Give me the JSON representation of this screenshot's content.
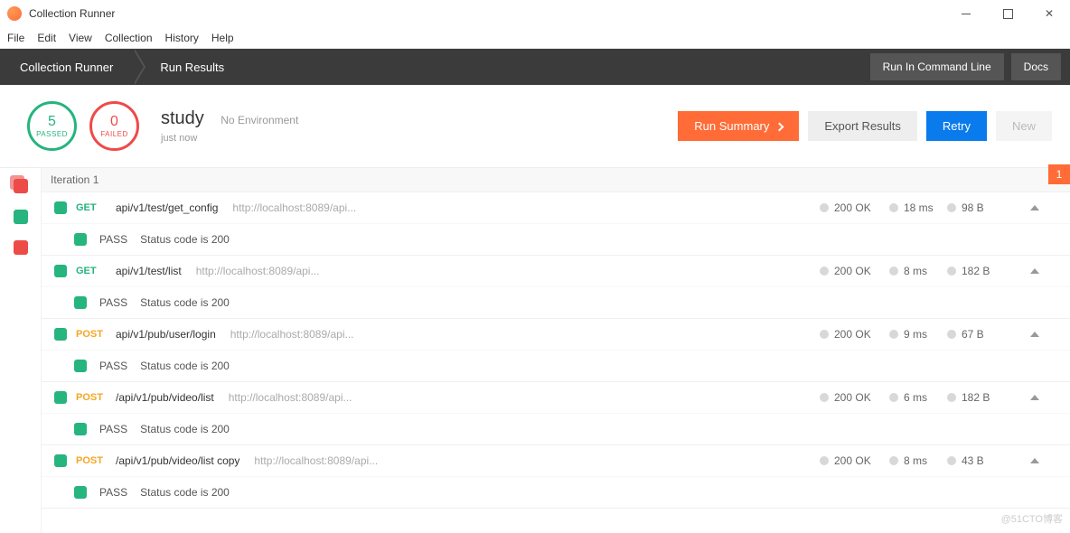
{
  "window": {
    "title": "Collection Runner"
  },
  "menu": [
    "File",
    "Edit",
    "View",
    "Collection",
    "History",
    "Help"
  ],
  "tabs": {
    "crumb1": "Collection Runner",
    "crumb2": "Run Results",
    "cmd": "Run In Command Line",
    "docs": "Docs"
  },
  "summary": {
    "passed_n": "5",
    "passed_l": "PASSED",
    "failed_n": "0",
    "failed_l": "FAILED",
    "name": "study",
    "env": "No Environment",
    "time": "just now"
  },
  "actions": {
    "run_summary": "Run Summary",
    "export": "Export Results",
    "retry": "Retry",
    "new": "New"
  },
  "iteration": {
    "label": "Iteration 1",
    "badge": "1"
  },
  "requests": [
    {
      "method": "GET",
      "mcls": "get",
      "path": "api/v1/test/get_config",
      "url": "http://localhost:8089/api...",
      "status": "200 OK",
      "time": "18 ms",
      "size": "98 B",
      "assert": "Status code is 200"
    },
    {
      "method": "GET",
      "mcls": "get",
      "path": "api/v1/test/list",
      "url": "http://localhost:8089/api...",
      "status": "200 OK",
      "time": "8 ms",
      "size": "182 B",
      "assert": "Status code is 200"
    },
    {
      "method": "POST",
      "mcls": "post",
      "path": "api/v1/pub/user/login",
      "url": "http://localhost:8089/api...",
      "status": "200 OK",
      "time": "9 ms",
      "size": "67 B",
      "assert": "Status code is 200"
    },
    {
      "method": "POST",
      "mcls": "post",
      "path": "/api/v1/pub/video/list",
      "url": "http://localhost:8089/api...",
      "status": "200 OK",
      "time": "6 ms",
      "size": "182 B",
      "assert": "Status code is 200"
    },
    {
      "method": "POST",
      "mcls": "post",
      "path": "/api/v1/pub/video/list copy",
      "url": "http://localhost:8089/api...",
      "status": "200 OK",
      "time": "8 ms",
      "size": "43 B",
      "assert": "Status code is 200"
    }
  ],
  "pass_label": "PASS",
  "watermark": "@51CTO博客"
}
